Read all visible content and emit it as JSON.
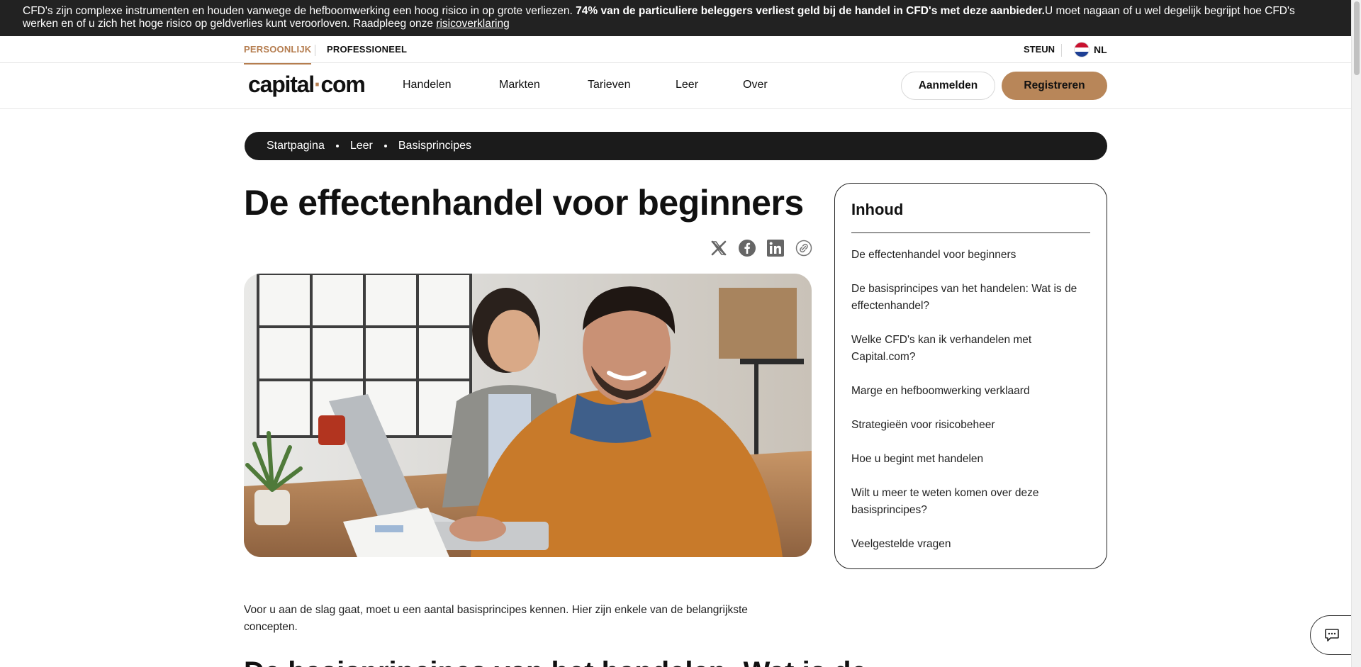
{
  "risk_banner": {
    "text_1": "CFD's zijn complexe instrumenten en houden vanwege de hefboomwerking een hoog risico in op grote verliezen. ",
    "bold": "74% van de particuliere beleggers verliest geld bij de handel in CFD's met deze aanbieder.",
    "text_2": "U moet nagaan of u wel degelijk begrijpt hoe CFD's werken en of u zich het hoge risico op geldverlies kunt veroorloven. Raadpleeg onze ",
    "link": "risicoverklaring"
  },
  "segment_bar": {
    "personal": "PERSOONLIJK",
    "professional": "PROFESSIONEEL",
    "support": "STEUN",
    "language": "NL"
  },
  "nav": {
    "logo_part1": "capital",
    "logo_dot": "·",
    "logo_part2": "com",
    "items": [
      "Handelen",
      "Markten",
      "Tarieven",
      "Leer",
      "Over"
    ],
    "login": "Aanmelden",
    "register": "Registreren"
  },
  "breadcrumb": [
    "Startpagina",
    "Leer",
    "Basisprincipes"
  ],
  "article": {
    "title": "De effectenhandel voor beginners",
    "intro": "Voor u aan de slag gaat, moet u een aantal basisprincipes kennen. Hier zijn enkele van de belangrijkste concepten.",
    "next_heading": "De basisprincipes van het handelen: Wat is de"
  },
  "share_icons": [
    "x-icon",
    "facebook-icon",
    "linkedin-icon",
    "copy-link-icon"
  ],
  "toc": {
    "title": "Inhoud",
    "items": [
      "De effectenhandel voor beginners",
      "De basisprincipes van het handelen: Wat is de effectenhandel?",
      "Welke CFD's kan ik verhandelen met Capital.com?",
      "Marge en hefboomwerking verklaard",
      "Strategieën voor risicobeheer",
      "Hoe u begint met handelen",
      "Wilt u meer te weten komen over deze basisprincipes?",
      "Veelgestelde vragen"
    ]
  },
  "colors": {
    "accent": "#b57d4f",
    "register_button": "#b88659",
    "banner_bg": "#222222",
    "breadcrumb_bg": "#1b1b1b"
  }
}
